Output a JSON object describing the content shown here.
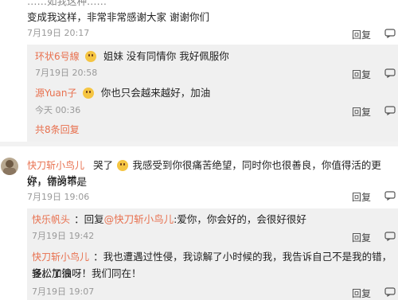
{
  "c1": {
    "line1": "……如我这种……",
    "line2": "变成我这样，非常非常感谢大家 谢谢你们",
    "time": "7月19日 20:17",
    "reply": "回复"
  },
  "r1": {
    "name": "环状6号線",
    "text": "姐妹 没有同情你 我好佩服你",
    "time": "7月19日 20:58",
    "reply": "回复"
  },
  "r2": {
    "name": "源Yuan子",
    "text": "你也只会越来越好，加油",
    "time": "今天 00:36",
    "reply": "回复"
  },
  "more": "共8条回复",
  "c2": {
    "name": "快刀斩小鸟儿",
    "prefix": "哭了",
    "line1": "我感受到你很痛苦绝望，同时你也很善良，你值得活的更好，错的不是",
    "line2": "你，你没错。",
    "time": "7月19日 19:06",
    "reply": "回复"
  },
  "r3": {
    "name": "快乐帆头",
    "reply_word": "回复",
    "mention": "@快刀斩小鸟儿",
    "text": ":爱你，你会好的，会很好很好",
    "time": "7月19日 19:42",
    "reply": "回复"
  },
  "r4": {
    "name": "快刀斩小鸟儿",
    "line1": "我也遭遇过性侵，我谅解了小时候的我，我告诉自己不是我的错，轻松了很",
    "line2": "多。加油呀！我们同在！",
    "time": "7月19日 19:07",
    "reply": "回复"
  },
  "colors": {
    "name": "#e8704e",
    "time": "#999999",
    "bg": "#f2f2f2"
  }
}
